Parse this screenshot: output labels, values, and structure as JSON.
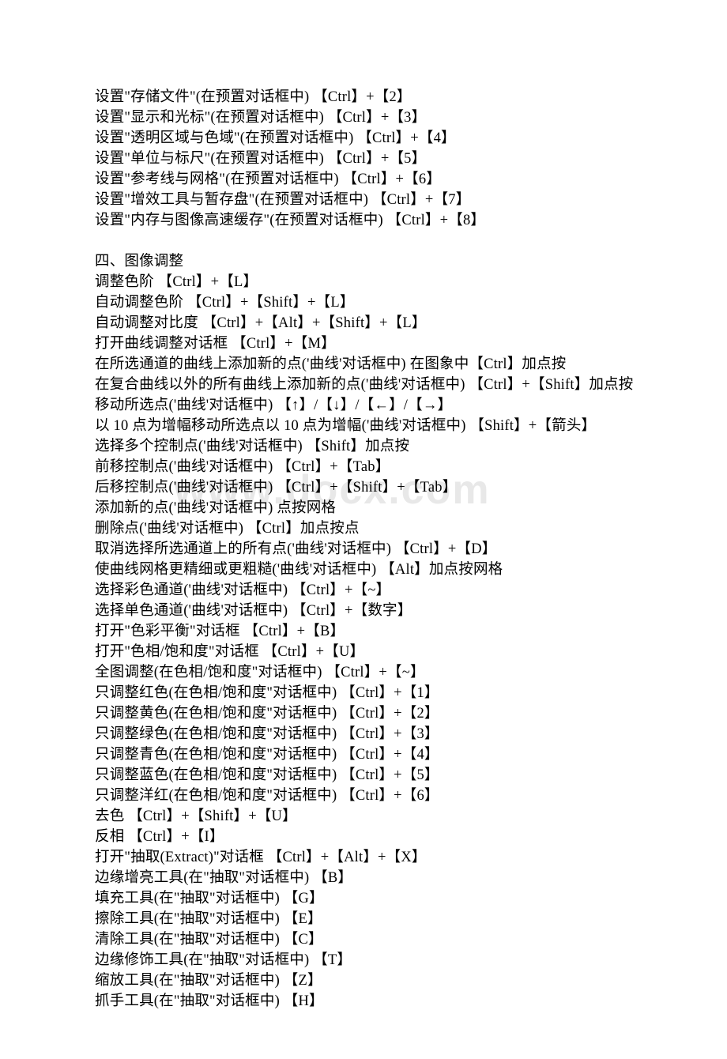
{
  "watermark": "www.docx.com",
  "lines": [
    "设置\"存储文件\"(在预置对话框中) 【Ctrl】+【2】",
    "设置\"显示和光标\"(在预置对话框中) 【Ctrl】+【3】",
    "设置\"透明区域与色域\"(在预置对话框中) 【Ctrl】+【4】",
    "设置\"单位与标尺\"(在预置对话框中) 【Ctrl】+【5】",
    "设置\"参考线与网格\"(在预置对话框中) 【Ctrl】+【6】",
    "设置\"增效工具与暂存盘\"(在预置对话框中) 【Ctrl】+【7】",
    "设置\"内存与图像高速缓存\"(在预置对话框中) 【Ctrl】+【8】",
    "",
    "四、图像调整",
    "调整色阶 【Ctrl】+【L】",
    "自动调整色阶 【Ctrl】+【Shift】+【L】",
    "自动调整对比度 【Ctrl】+【Alt】+【Shift】+【L】",
    "打开曲线调整对话框 【Ctrl】+【M】",
    "在所选通道的曲线上添加新的点('曲线'对话框中) 在图象中【Ctrl】加点按",
    "在复合曲线以外的所有曲线上添加新的点('曲线'对话框中) 【Ctrl】+【Shift】加点按",
    "移动所选点('曲线'对话框中) 【↑】/【↓】/【←】/【→】",
    "以 10 点为增幅移动所选点以 10 点为增幅('曲线'对话框中) 【Shift】+【箭头】",
    "选择多个控制点('曲线'对话框中) 【Shift】加点按",
    "前移控制点('曲线'对话框中) 【Ctrl】+【Tab】",
    "后移控制点('曲线'对话框中) 【Ctrl】+【Shift】+【Tab】",
    "添加新的点('曲线'对话框中) 点按网格",
    "删除点('曲线'对话框中) 【Ctrl】加点按点",
    "取消选择所选通道上的所有点('曲线'对话框中) 【Ctrl】+【D】",
    "使曲线网格更精细或更粗糙('曲线'对话框中) 【Alt】加点按网格",
    "选择彩色通道('曲线'对话框中) 【Ctrl】+【~】",
    "选择单色通道('曲线'对话框中) 【Ctrl】+【数字】",
    "打开\"色彩平衡\"对话框 【Ctrl】+【B】",
    "打开\"色相/饱和度\"对话框 【Ctrl】+【U】",
    "全图调整(在色相/饱和度\"对话框中) 【Ctrl】+【~】",
    "只调整红色(在色相/饱和度\"对话框中) 【Ctrl】+【1】",
    "只调整黄色(在色相/饱和度\"对话框中) 【Ctrl】+【2】",
    "只调整绿色(在色相/饱和度\"对话框中) 【Ctrl】+【3】",
    "只调整青色(在色相/饱和度\"对话框中) 【Ctrl】+【4】",
    "只调整蓝色(在色相/饱和度\"对话框中) 【Ctrl】+【5】",
    "只调整洋红(在色相/饱和度\"对话框中) 【Ctrl】+【6】",
    "去色 【Ctrl】+【Shift】+【U】",
    "反相 【Ctrl】+【I】",
    "打开\"抽取(Extract)\"对话框 【Ctrl】+【Alt】+【X】",
    "边缘增亮工具(在\"抽取\"对话框中) 【B】",
    "填充工具(在\"抽取\"对话框中) 【G】",
    "擦除工具(在\"抽取\"对话框中) 【E】",
    "清除工具(在\"抽取\"对话框中) 【C】",
    "边缘修饰工具(在\"抽取\"对话框中) 【T】",
    "缩放工具(在\"抽取\"对话框中) 【Z】",
    "抓手工具(在\"抽取\"对话框中) 【H】"
  ]
}
